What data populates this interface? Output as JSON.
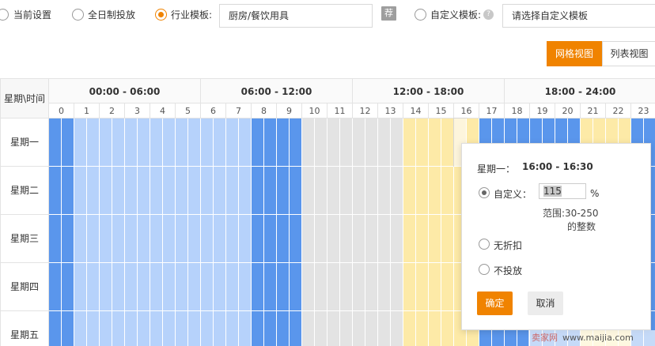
{
  "mode_options": [
    {
      "label": "当前设置",
      "selected": false
    },
    {
      "label": "全日制投放",
      "selected": false
    },
    {
      "label": "行业模板:",
      "selected": true
    },
    {
      "label": "自定义模板:",
      "selected": false
    }
  ],
  "industry_template_value": "厨房/餐饮用具",
  "recommend_badge": "荐",
  "custom_template_placeholder": "请选择自定义模板",
  "help_icon": "?",
  "views": {
    "grid": "网格视图",
    "list": "列表视图",
    "active": "grid"
  },
  "grid": {
    "corner_label": "星期\\时间",
    "periods": [
      "00:00 - 06:00",
      "06:00 - 12:00",
      "12:00 - 18:00",
      "18:00 - 24:00"
    ],
    "hours": [
      "0",
      "1",
      "2",
      "3",
      "4",
      "5",
      "6",
      "7",
      "8",
      "9",
      "10",
      "11",
      "12",
      "13",
      "14",
      "15",
      "16",
      "17",
      "18",
      "19",
      "20",
      "21",
      "22",
      "23"
    ],
    "days": [
      "星期一",
      "星期二",
      "星期三",
      "星期四",
      "星期五"
    ],
    "legend_colors": {
      "high": "#5a96ec",
      "low": "#b6d2fb",
      "off": "#e3e3e3",
      "mid": "#fdeaa7"
    },
    "hour_levels": [
      "high",
      "low",
      "low",
      "low",
      "low",
      "low",
      "low",
      "low",
      "high",
      "high",
      "off",
      "off",
      "off",
      "off",
      "mid",
      "mid",
      "mid",
      "high",
      "high",
      "high",
      "high",
      "mid",
      "mid",
      "high"
    ],
    "selected_cell": {
      "day": "星期一",
      "range": "16:00 - 16:30"
    }
  },
  "popup": {
    "day_label": "星期一：",
    "time_range": "16:00 - 16:30",
    "custom_label": "自定义：",
    "custom_value": "115",
    "unit": "%",
    "range_hint_1": "范围:30-250",
    "range_hint_2": "的整数",
    "no_discount_label": "无折扣",
    "no_delivery_label": "不投放",
    "selected_option": "custom",
    "confirm_label": "确定",
    "cancel_label": "取消"
  },
  "watermark": {
    "text": "卖家网",
    "url": "www.maijia.com"
  }
}
